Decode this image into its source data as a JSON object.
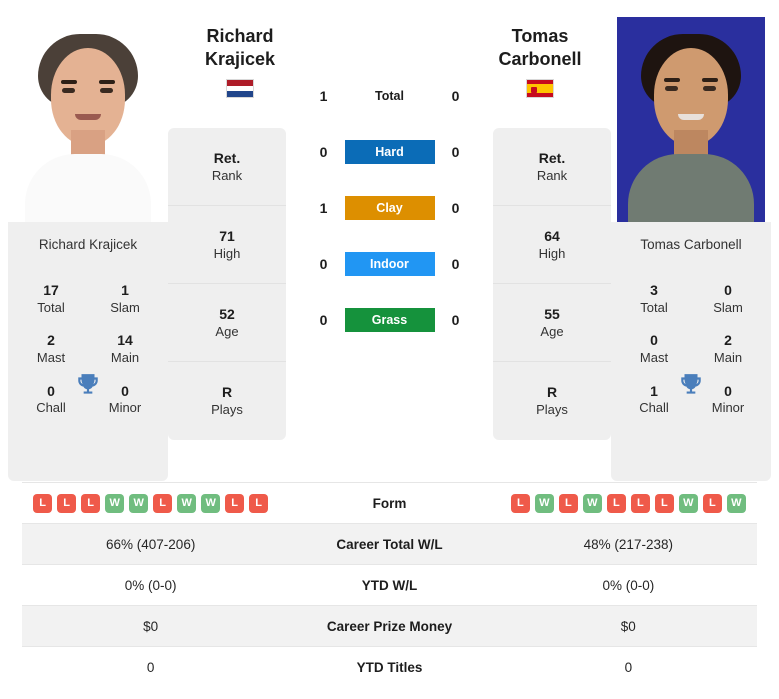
{
  "players": {
    "left": {
      "first_name": "Richard",
      "last_name": "Krajicek",
      "full_name": "Richard Krajicek",
      "country": "Netherlands",
      "flag": "nl-flag-icon",
      "photo": "player-photo-krajicek",
      "titles": {
        "total": "17",
        "total_label": "Total",
        "slam": "1",
        "slam_label": "Slam",
        "mast": "2",
        "mast_label": "Mast",
        "main": "14",
        "main_label": "Main",
        "chall": "0",
        "chall_label": "Chall",
        "minor": "0",
        "minor_label": "Minor"
      },
      "info": [
        {
          "value": "Ret.",
          "label": "Rank"
        },
        {
          "value": "71",
          "label": "High"
        },
        {
          "value": "52",
          "label": "Age"
        },
        {
          "value": "R",
          "label": "Plays"
        }
      ],
      "surface_scores": {
        "total": "1",
        "hard": "0",
        "clay": "1",
        "indoor": "0",
        "grass": "0"
      },
      "form": [
        "L",
        "L",
        "L",
        "W",
        "W",
        "L",
        "W",
        "W",
        "L",
        "L"
      ],
      "career_total_wl": "66% (407-206)",
      "ytd_wl": "0% (0-0)",
      "career_prize_money": "$0",
      "ytd_titles": "0"
    },
    "right": {
      "first_name": "Tomas",
      "last_name": "Carbonell",
      "full_name": "Tomas Carbonell",
      "country": "Spain",
      "flag": "es-flag-icon",
      "photo": "player-photo-carbonell",
      "titles": {
        "total": "3",
        "total_label": "Total",
        "slam": "0",
        "slam_label": "Slam",
        "mast": "0",
        "mast_label": "Mast",
        "main": "2",
        "main_label": "Main",
        "chall": "1",
        "chall_label": "Chall",
        "minor": "0",
        "minor_label": "Minor"
      },
      "info": [
        {
          "value": "Ret.",
          "label": "Rank"
        },
        {
          "value": "64",
          "label": "High"
        },
        {
          "value": "55",
          "label": "Age"
        },
        {
          "value": "R",
          "label": "Plays"
        }
      ],
      "surface_scores": {
        "total": "0",
        "hard": "0",
        "clay": "0",
        "indoor": "0",
        "grass": "0"
      },
      "form": [
        "L",
        "W",
        "L",
        "W",
        "L",
        "L",
        "L",
        "W",
        "L",
        "W"
      ],
      "career_total_wl": "48% (217-238)",
      "ytd_wl": "0% (0-0)",
      "career_prize_money": "$0",
      "ytd_titles": "0"
    }
  },
  "surfaces": [
    {
      "key": "total",
      "label": "Total",
      "color": "transparent",
      "text_color": "#1d1d1d"
    },
    {
      "key": "hard",
      "label": "Hard",
      "color": "#0b6cb7",
      "text_color": "#ffffff"
    },
    {
      "key": "clay",
      "label": "Clay",
      "color": "#dd8f00",
      "text_color": "#ffffff"
    },
    {
      "key": "indoor",
      "label": "Indoor",
      "color": "#2196f3",
      "text_color": "#ffffff"
    },
    {
      "key": "grass",
      "label": "Grass",
      "color": "#15923c",
      "text_color": "#ffffff"
    }
  ],
  "table": {
    "form_label": "Form",
    "rows": [
      {
        "label": "Career Total W/L",
        "left": "66% (407-206)",
        "right": "48% (217-238)"
      },
      {
        "label": "YTD W/L",
        "left": "0% (0-0)",
        "right": "0% (0-0)"
      },
      {
        "label": "Career Prize Money",
        "left": "$0",
        "right": "$0"
      },
      {
        "label": "YTD Titles",
        "left": "0",
        "right": "0"
      }
    ]
  },
  "colors": {
    "win": "#70bd7f",
    "loss": "#ef5a4a",
    "card_bg": "#efefef",
    "row_shade": "#f2f2f2",
    "trophy": "#4a7ebb"
  },
  "icons": {
    "trophy": "trophy-icon"
  }
}
